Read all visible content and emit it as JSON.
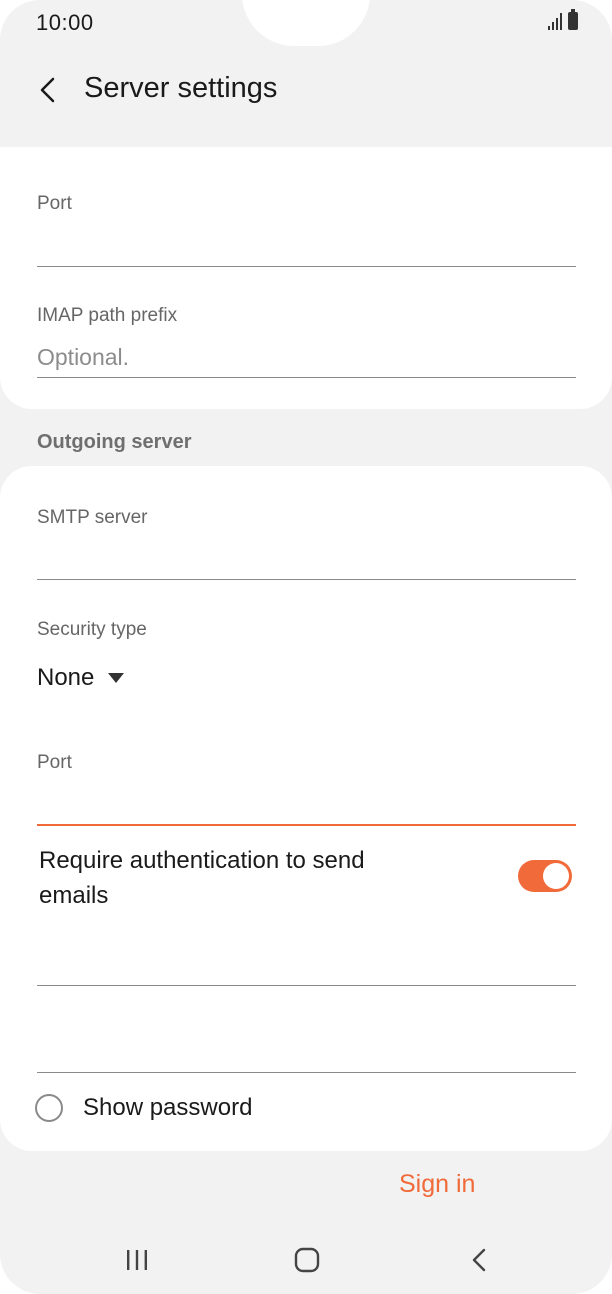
{
  "status_bar": {
    "time": "10:00"
  },
  "header": {
    "title": "Server settings"
  },
  "incoming": {
    "port_label": "Port",
    "port_value": "",
    "imap_prefix_label": "IMAP path prefix",
    "imap_prefix_placeholder": "Optional."
  },
  "outgoing": {
    "section_title": "Outgoing server",
    "smtp_label": "SMTP server",
    "smtp_value": "",
    "security_label": "Security type",
    "security_value": "None",
    "port_label": "Port",
    "port_value": "",
    "require_auth_label": "Require authentication to send emails",
    "require_auth_enabled": true,
    "username_value": "",
    "password_value": "",
    "show_password_label": "Show password",
    "show_password_checked": false
  },
  "actions": {
    "sign_in_label": "Sign in"
  },
  "colors": {
    "accent": "#f06a3a",
    "background": "#f2f2f2",
    "card": "#ffffff"
  },
  "icons": {
    "back": "back-arrow-icon",
    "dropdown": "triangle-down-icon",
    "nav_recents": "recents-icon",
    "nav_home": "home-icon",
    "nav_back": "nav-back-icon"
  }
}
